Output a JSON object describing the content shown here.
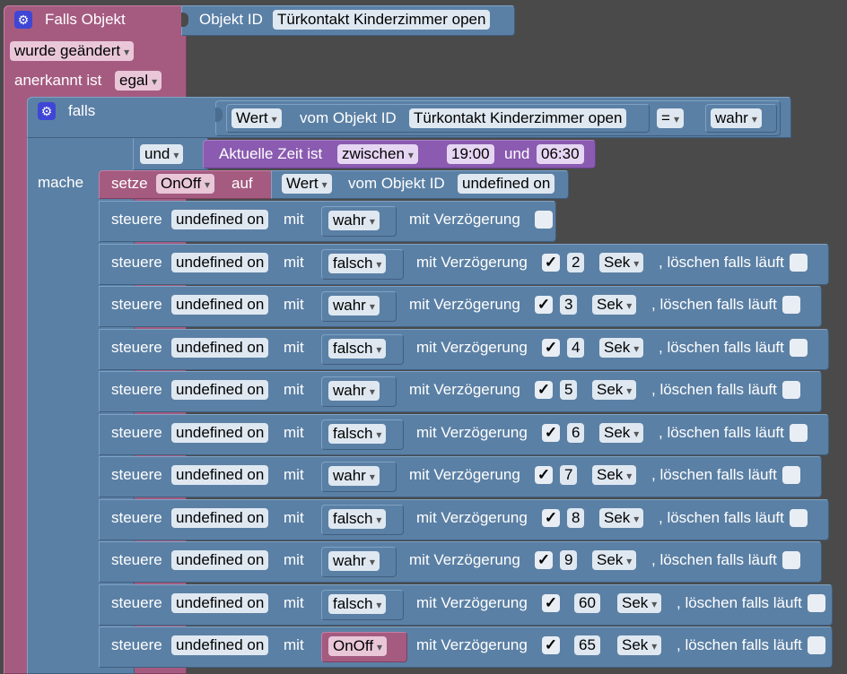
{
  "trigger": {
    "title": "Falls Objekt",
    "object_id_label": "Objekt ID",
    "object_id_value": "Türkontakt Kinderzimmer open",
    "changed_option": "wurde geändert",
    "ack_label": "anerkannt ist",
    "ack_option": "egal"
  },
  "if_block": {
    "label": "falls",
    "value_option": "Wert",
    "from_object_label": "vom Objekt ID",
    "object_id_value": "Türkontakt Kinderzimmer open",
    "operator": "=",
    "compare_value": "wahr",
    "logic_option": "und",
    "time_label": "Aktuelle Zeit ist",
    "time_option": "zwischen",
    "time_from": "19:00",
    "time_and": "und",
    "time_to": "06:30",
    "do_label": "mache"
  },
  "set_block": {
    "label": "setze",
    "variable": "OnOff",
    "to_label": "auf",
    "value_option": "Wert",
    "from_object_label": "vom Objekt ID",
    "object_id_value": "undefined on"
  },
  "labels": {
    "control": "steuere",
    "with": "mit",
    "delay": "mit Verzögerung",
    "unit": "Sek",
    "clear": ", löschen falls läuft",
    "check": "✓"
  },
  "controls": [
    {
      "target": "undefined on",
      "value": "wahr",
      "delay_checked": false,
      "delay": null
    },
    {
      "target": "undefined on",
      "value": "falsch",
      "delay_checked": true,
      "delay": "2"
    },
    {
      "target": "undefined on",
      "value": "wahr",
      "delay_checked": true,
      "delay": "3"
    },
    {
      "target": "undefined on",
      "value": "falsch",
      "delay_checked": true,
      "delay": "4"
    },
    {
      "target": "undefined on",
      "value": "wahr",
      "delay_checked": true,
      "delay": "5"
    },
    {
      "target": "undefined on",
      "value": "falsch",
      "delay_checked": true,
      "delay": "6"
    },
    {
      "target": "undefined on",
      "value": "wahr",
      "delay_checked": true,
      "delay": "7"
    },
    {
      "target": "undefined on",
      "value": "falsch",
      "delay_checked": true,
      "delay": "8"
    },
    {
      "target": "undefined on",
      "value": "wahr",
      "delay_checked": true,
      "delay": "9"
    },
    {
      "target": "undefined on",
      "value": "falsch",
      "delay_checked": true,
      "delay": "60"
    },
    {
      "target": "undefined on",
      "value": "OnOff",
      "delay_checked": true,
      "delay": "65"
    }
  ]
}
